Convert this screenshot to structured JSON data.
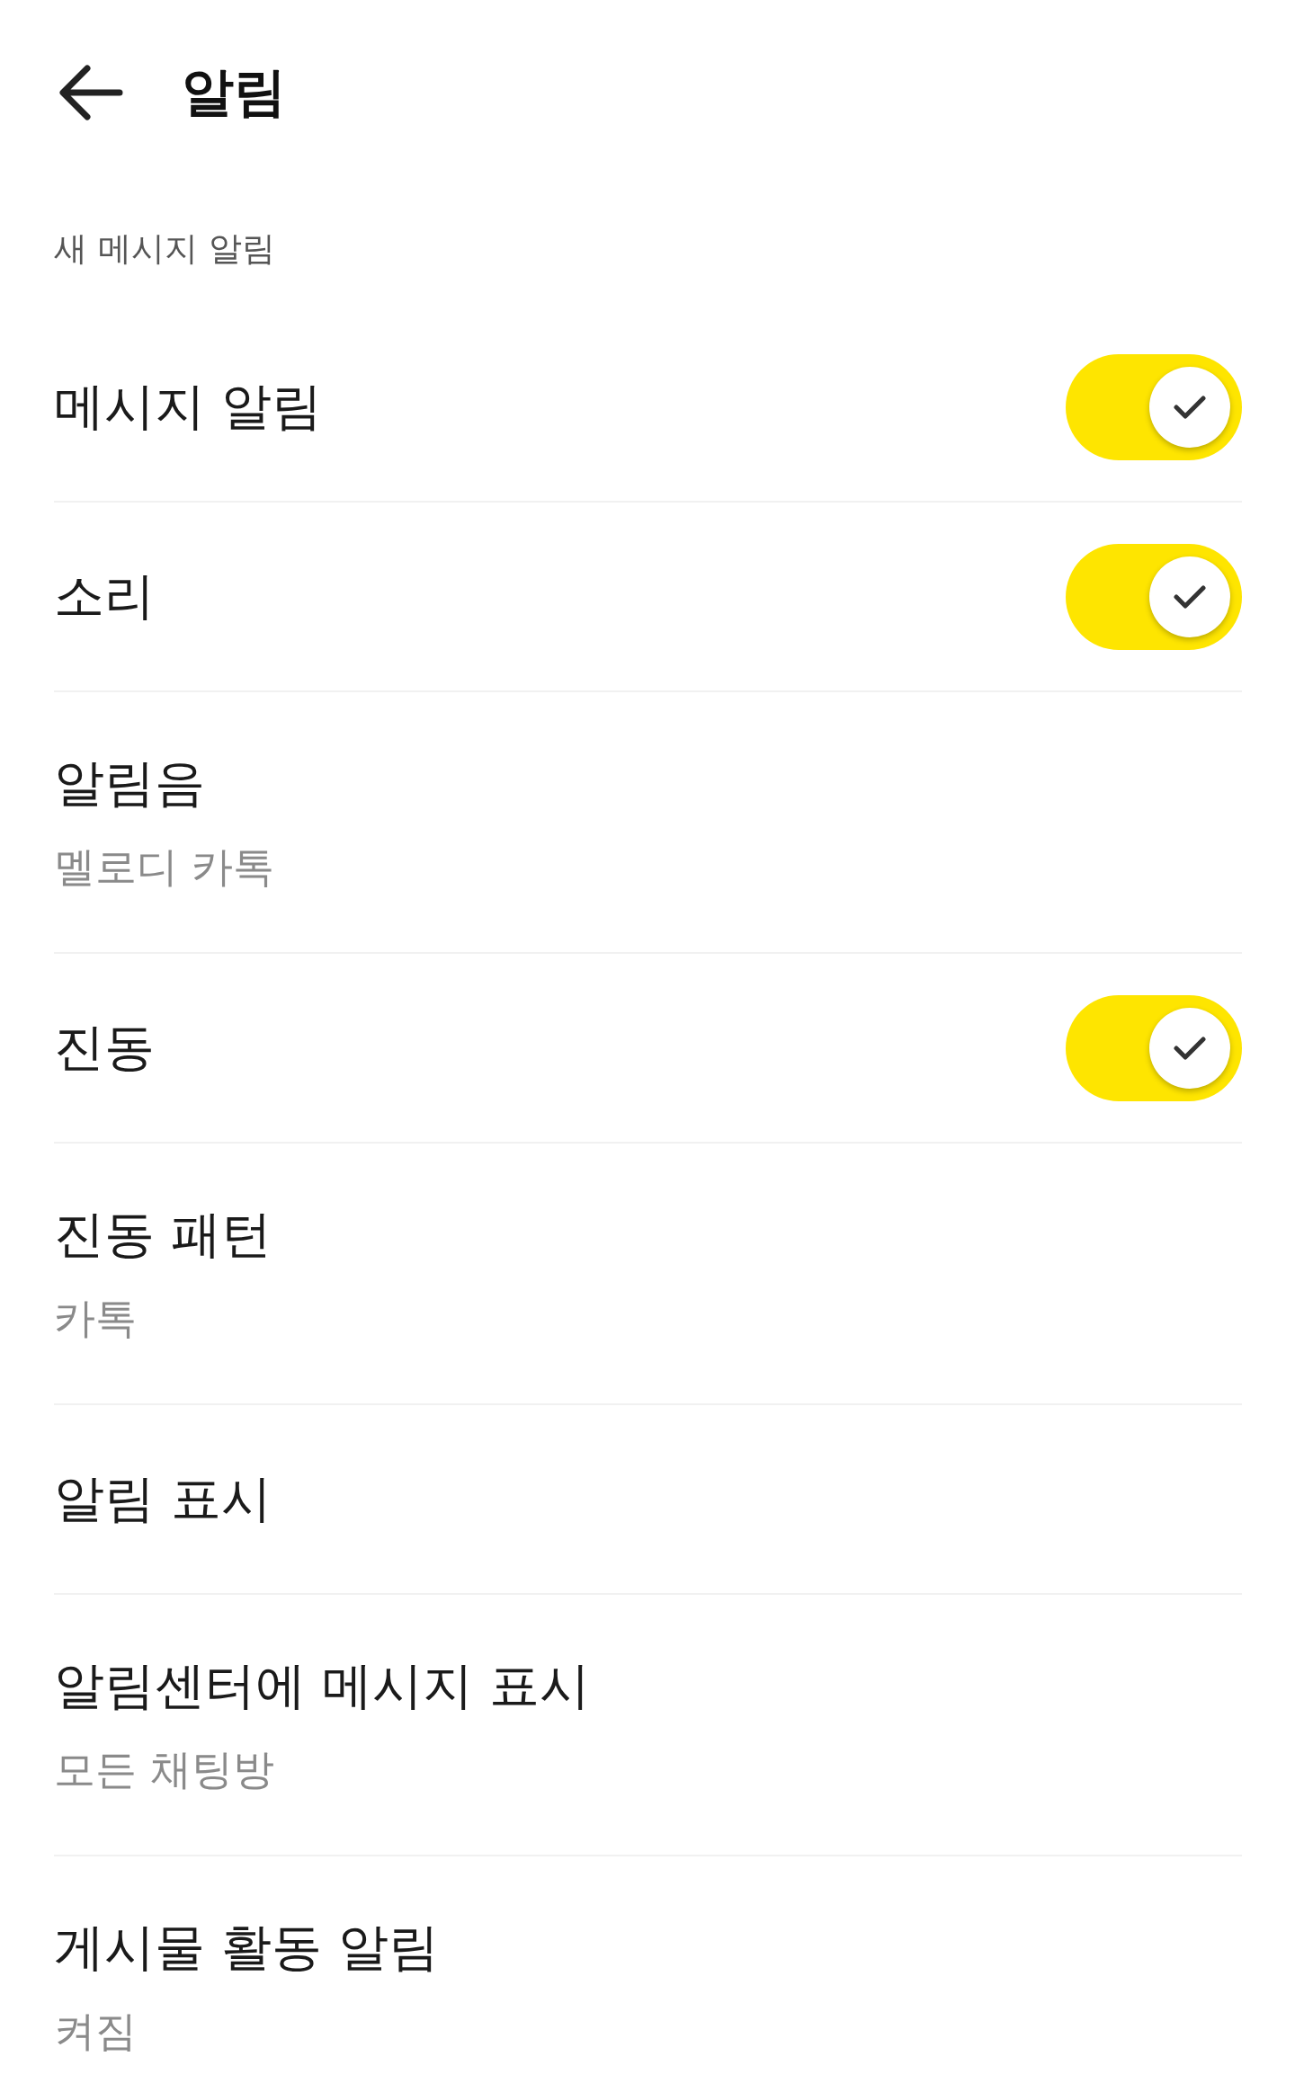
{
  "header": {
    "title": "알림"
  },
  "section": {
    "title": "새 메시지 알림"
  },
  "rows": [
    {
      "kind": "toggle",
      "label": "메시지 알림",
      "on": true
    },
    {
      "kind": "toggle",
      "label": "소리",
      "on": true
    },
    {
      "kind": "value",
      "label": "알림음",
      "value": "멜로디 카톡"
    },
    {
      "kind": "toggle",
      "label": "진동",
      "on": true
    },
    {
      "kind": "value",
      "label": "진동 패턴",
      "value": "카톡"
    },
    {
      "kind": "plain",
      "label": "알림 표시"
    },
    {
      "kind": "value",
      "label": "알림센터에 메시지 표시",
      "value": "모든 채팅방"
    },
    {
      "kind": "value",
      "label": "게시물 활동 알림",
      "value": "켜짐"
    }
  ]
}
